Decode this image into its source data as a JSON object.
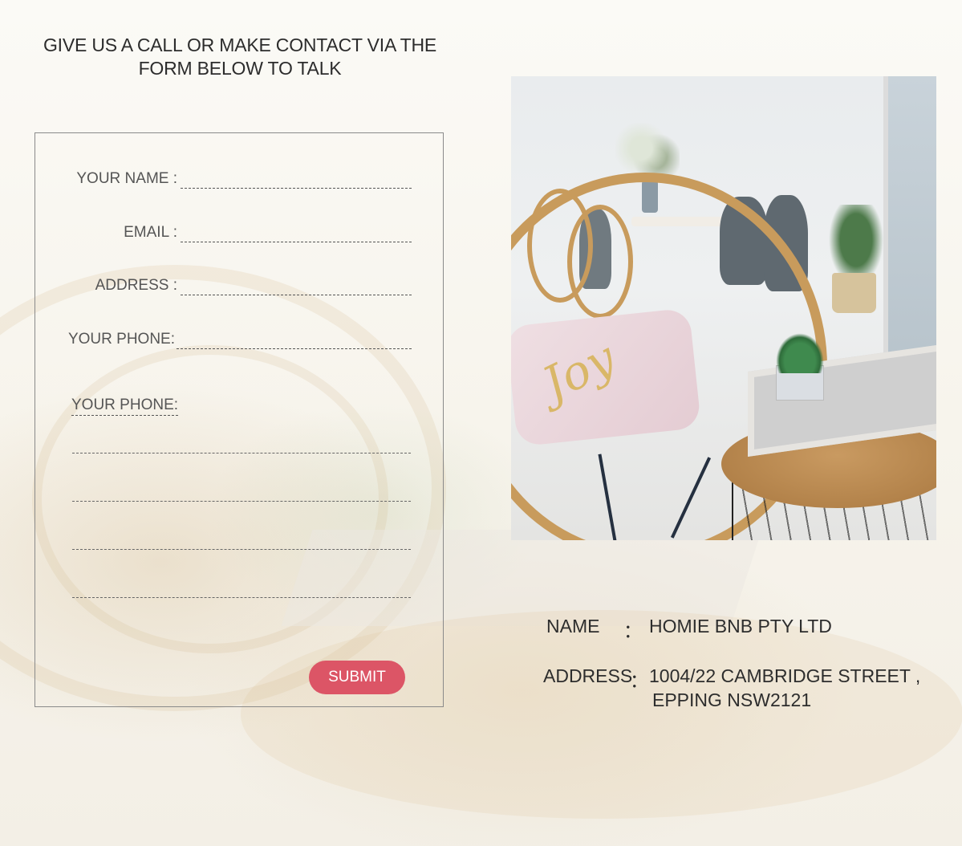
{
  "headline": "GIVE US A CALL OR MAKE CONTACT VIA THE FORM BELOW TO TALK",
  "form": {
    "fields": [
      {
        "label": "YOUR NAME :"
      },
      {
        "label": "EMAIL :"
      },
      {
        "label": "ADDRESS :"
      },
      {
        "label": "YOUR PHONE:"
      }
    ],
    "message_label": "YOUR PHONE:",
    "submit_label": "SUBMIT"
  },
  "photo": {
    "pillow_text": "Joy"
  },
  "company": {
    "name_label": "NAME",
    "name_sep": "：",
    "name_value": "HOMIE BNB PTY LTD",
    "address_label": "ADDRESS",
    "address_sep": "：",
    "address_line1": "1004/22 CAMBRIDGE STREET ,",
    "address_line2": "EPPING NSW2121"
  },
  "colors": {
    "submit_button": "#dc5566",
    "background": "#f6f4ef"
  }
}
